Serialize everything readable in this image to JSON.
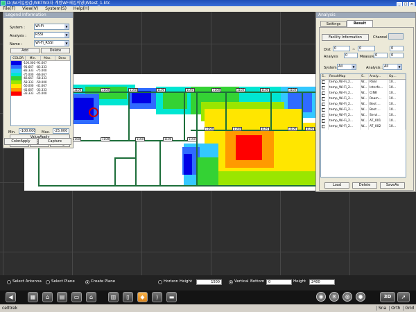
{
  "window": {
    "title": "D:\\W거일점검\\WKTW3차 계방WF재입의영\\Wtest_1.ktc"
  },
  "menu": {
    "file": "File(F)",
    "view": "View(V)",
    "system": "System(S)",
    "help": "Help(H)"
  },
  "legend_panel": {
    "title": "Legend Information",
    "system_label": "System :",
    "system_value": "Wi-Fi",
    "analysis_label": "Analysis :",
    "analysis_value": "RSSI",
    "name_label": "Name :",
    "name_value": "Wi-Fi_RSSI",
    "add_label": "Add",
    "delete_label": "Delete",
    "table_headers": [
      "COLOR",
      "Min.",
      "Max.",
      "Desc"
    ],
    "rows": [
      {
        "color": "#0000e6",
        "min": "-100.000",
        "max": "-91.667"
      },
      {
        "color": "#2f6bff",
        "min": "-91.667",
        "max": "-83.333"
      },
      {
        "color": "#33c8ff",
        "min": "-83.333",
        "max": "-75.000"
      },
      {
        "color": "#00e6d2",
        "min": "-75.000",
        "max": "-66.667"
      },
      {
        "color": "#34d234",
        "min": "-66.667",
        "max": "-58.333"
      },
      {
        "color": "#9ae600",
        "min": "-58.333",
        "max": "-50.000"
      },
      {
        "color": "#ffe600",
        "min": "-50.000",
        "max": "-41.667"
      },
      {
        "color": "#ff9a00",
        "min": "-41.667",
        "max": "-33.333"
      },
      {
        "color": "#ff0000",
        "min": "-33.333",
        "max": "-25.000"
      }
    ],
    "min_label": "Min.",
    "min_value": "-100.000",
    "max_label": "Max.",
    "max_value": "-25.000",
    "valueapply_label": "ValueApply",
    "add2_label": "Add",
    "delete2_label": "Delete",
    "change_label": "Change",
    "colorapply_label": "ColorApply",
    "capture_label": "Capture"
  },
  "analysis_panel": {
    "title": "Analysis",
    "tab_settings": "Settings",
    "tab_result": "Result",
    "facility_button": "Facility Information",
    "channel_label": "Channel :",
    "dist_label": "Dist",
    "dist_from": "0",
    "dist_tilde": "~",
    "dist_to": "0",
    "analysis_label": "Analysis",
    "analysis_value": "0",
    "measured_label": "Measured",
    "measured_value": "0",
    "field_a": "0",
    "field_b": "0",
    "system_label": "System :",
    "system_value": "All",
    "analysis_filter_label": "Analysis :",
    "analysis_filter_value": "All",
    "table_headers": [
      "S..",
      "ResultMap",
      "S..",
      "Analy...",
      "Op..."
    ],
    "rows": [
      {
        "checked": false,
        "map": "temp_Wi-Fi_2...",
        "s": "W...",
        "analysis": "RSSI",
        "op": "10..."
      },
      {
        "checked": false,
        "map": "temp_Wi-Fi_2...",
        "s": "W...",
        "analysis": "Interfe...",
        "op": "10..."
      },
      {
        "checked": false,
        "map": "temp_Wi-Fi_2...",
        "s": "W...",
        "analysis": "CINR",
        "op": "10..."
      },
      {
        "checked": false,
        "map": "temp_Wi-Fi_2...",
        "s": "W...",
        "analysis": "Roam...",
        "op": "10..."
      },
      {
        "checked": false,
        "map": "temp_Wi-Fi_2...",
        "s": "W...",
        "analysis": "Best ...",
        "op": "10..."
      },
      {
        "checked": false,
        "map": "temp_Wi-Fi_2...",
        "s": "W...",
        "analysis": "Best ...",
        "op": "10..."
      },
      {
        "checked": false,
        "map": "temp_Wi-Fi_2...",
        "s": "W...",
        "analysis": "Servi...",
        "op": "10..."
      },
      {
        "checked": true,
        "map": "temp_Wi-Fi_2...",
        "s": "W...",
        "analysis": "AT_001",
        "op": "10..."
      },
      {
        "checked": false,
        "map": "temp_Wi-Fi_2...",
        "s": "W...",
        "analysis": "AT_002",
        "op": "10..."
      }
    ],
    "load_label": "Load",
    "delete_label": "Delete",
    "saveas_label": "SaveAs"
  },
  "options": {
    "select_antenna": "Select Antenna",
    "select_plane": "Select Plane",
    "create_plane": "Create Plane",
    "horizon": "Horizon",
    "height_label": "Height",
    "height_value": "1500",
    "vertical": "Vertical",
    "bottom_label": "Bottom",
    "bottom_value": "0",
    "height2_label": "Height",
    "height2_value": "2400",
    "selected": "create_plane"
  },
  "toolbar": {
    "view_3d": "3D"
  },
  "status": {
    "left": "celltrek",
    "sna": "Sna",
    "orth": "Orth",
    "grid": "Grid"
  },
  "floorplan": {
    "dimensions": [
      "1160",
      "1100",
      "1100",
      "1100",
      "1100",
      "1160",
      "1100",
      "1160",
      "1100",
      "1160",
      "1100",
      "1160",
      "1100",
      "1160",
      "1100",
      "1160",
      "1160",
      "1100",
      "1160",
      "1100",
      "1100"
    ]
  }
}
